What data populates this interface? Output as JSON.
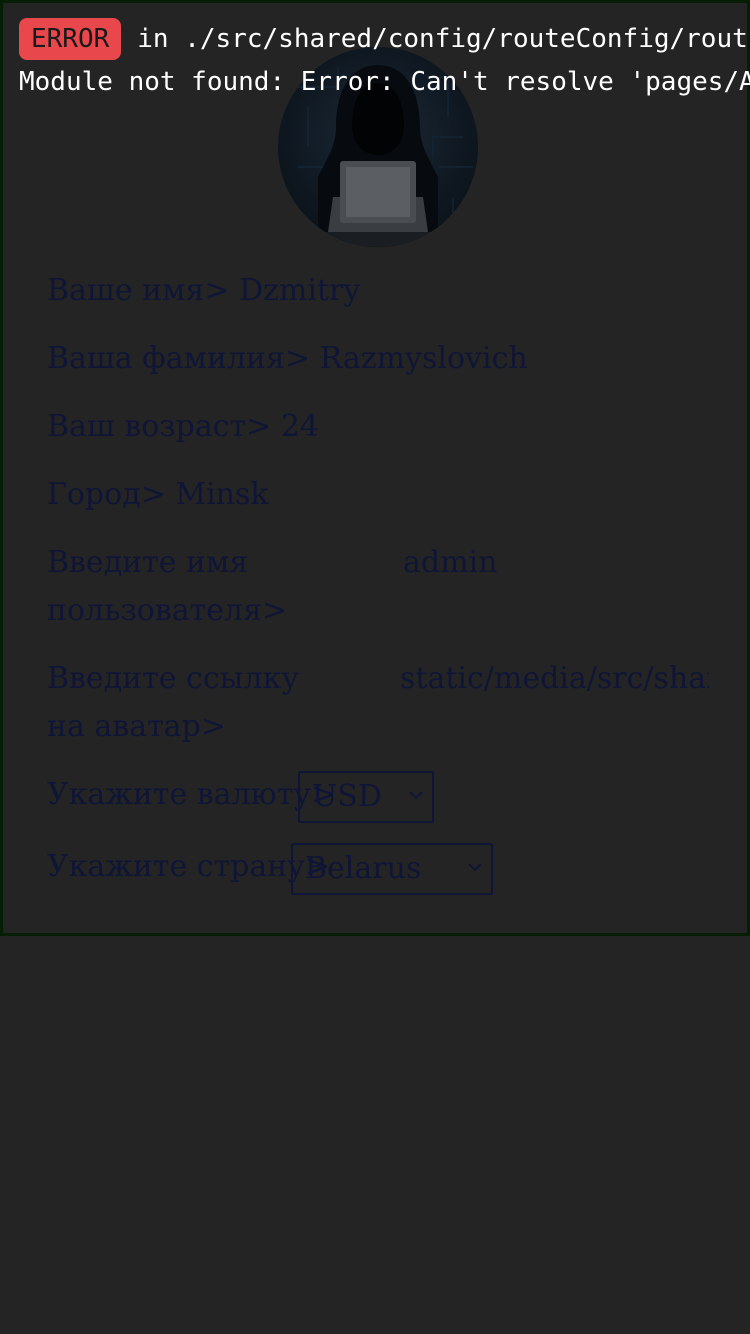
{
  "error_overlay": {
    "badge": "ERROR",
    "location": "in ./src/shared/config/routeConfig/rout",
    "message": "Module not found: Error: Can't resolve 'pages/A"
  },
  "profile": {
    "avatar_icon": "hooded-hacker-avatar",
    "first_name": {
      "label": "Ваше имя>",
      "value": "Dzmitry"
    },
    "last_name": {
      "label": "Ваша фамилия>",
      "value": "Razmyslovich"
    },
    "age": {
      "label": "Ваш возраст>",
      "value": "24"
    },
    "city": {
      "label": "Город>",
      "value": "Minsk"
    },
    "username": {
      "label": "Введите имя пользователя>",
      "value": "admin"
    },
    "avatar_link": {
      "label": "Введите ссылку на аватар>",
      "value": "static/media/src/shared/a"
    },
    "currency": {
      "label": "Укажите валюту>",
      "selected": "USD"
    },
    "country": {
      "label": "Укажите страну>",
      "selected": "Belarus"
    }
  },
  "colors": {
    "page_bg": "#242424",
    "card_border": "#061e06",
    "text": "#0f1536",
    "error_badge": "#e8474b",
    "overlay_text": "#ffffff"
  }
}
